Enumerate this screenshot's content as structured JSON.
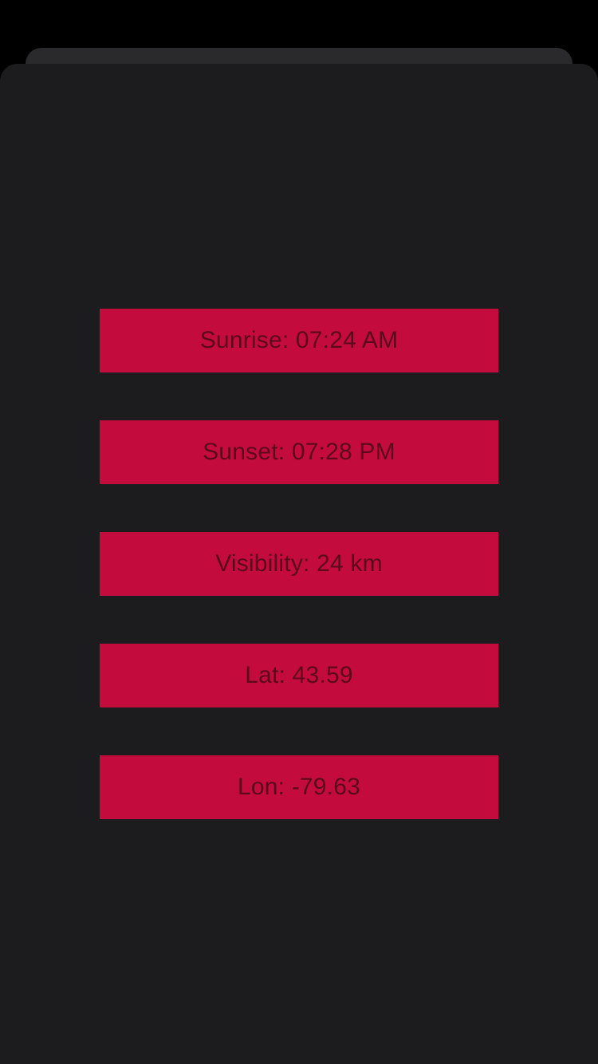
{
  "colors": {
    "background": "#000000",
    "sheet": "#1c1c1e",
    "sheet_back": "#2a2a2c",
    "row_background": "#c40b3e",
    "row_text": "#5a0a1c"
  },
  "info_rows": [
    {
      "text": "Sunrise: 07:24 AM"
    },
    {
      "text": "Sunset: 07:28 PM"
    },
    {
      "text": "Visibility: 24 km"
    },
    {
      "text": "Lat: 43.59"
    },
    {
      "text": "Lon: -79.63"
    }
  ]
}
